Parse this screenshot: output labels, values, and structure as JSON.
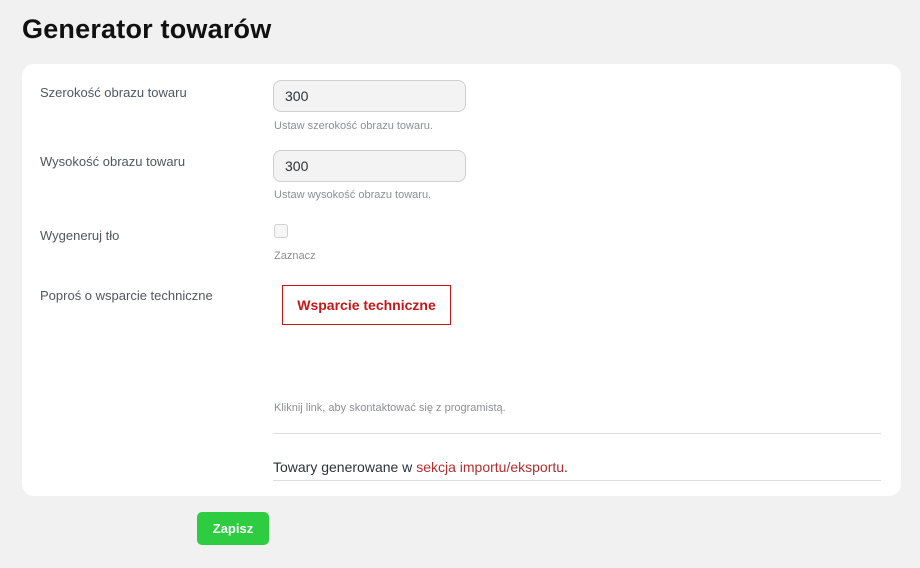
{
  "page": {
    "title": "Generator towarów"
  },
  "settings": {
    "image_width": {
      "label": "Szerokość obrazu towaru",
      "value": "300",
      "hint": "Ustaw szerokość obrazu towaru."
    },
    "image_height": {
      "label": "Wysokość obrazu towaru",
      "value": "300",
      "hint": "Ustaw wysokość obrazu towaru."
    },
    "generate_background": {
      "label": "Wygeneruj tło",
      "checked": false,
      "hint": "Zaznacz"
    },
    "support": {
      "label": "Poproś o wsparcie techniczne",
      "button_label": "Wsparcie techniczne",
      "hint": "Kliknij link, aby skontaktować się z programistą."
    },
    "footer_note": {
      "text_before": "Towary generowane w ",
      "link_text": "sekcja importu/eksportu",
      "text_after": "."
    }
  },
  "actions": {
    "save_label": "Zapisz"
  },
  "colors": {
    "accent_red": "#c41717",
    "link_red": "#b32d2e",
    "save_green": "#2ecc40"
  }
}
